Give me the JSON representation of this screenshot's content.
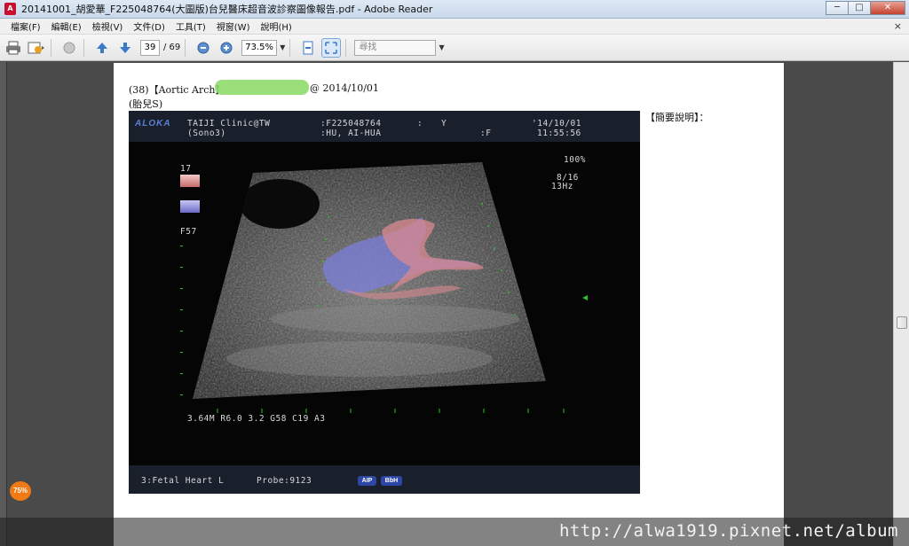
{
  "window": {
    "title": "20141001_胡愛華_F225048764(大圖版)台兒醫床超音波診察圖像報告.pdf - Adobe Reader",
    "app_icon": "pdf-icon",
    "buttons": [
      "─",
      "□",
      "✕"
    ]
  },
  "menu": {
    "items": [
      "檔案(F)",
      "編輯(E)",
      "檢視(V)",
      "文件(D)",
      "工具(T)",
      "視窗(W)",
      "說明(H)"
    ],
    "close": "×"
  },
  "toolbar": {
    "page_current": "39",
    "page_total": "/ 69",
    "zoom": "73.5%",
    "search_placeholder": "尋找",
    "icons": [
      "print-icon",
      "email-icon",
      "collaborate-icon",
      "page-up-icon",
      "page-down-icon",
      "zoom-out-icon",
      "zoom-in-icon",
      "fit-page-icon",
      "fullscreen-icon"
    ]
  },
  "document": {
    "heading_prefix": "(38)【Aortic Arch】",
    "heading_suffix": "@ 2014/10/01",
    "subheading": "(胎兒S)",
    "side_note": "【簡要說明】："
  },
  "ultrasound": {
    "brand": "ALOKA",
    "clinic": "TAIJI Clinic@TW",
    "probe_mode": "(Sono3)",
    "patient_id": ":F225048764",
    "id_sep": ":",
    "id_flag": "Y",
    "patient_name": ":HU, AI-HUA",
    "sex": ":F",
    "date": "'14/10/01",
    "time": "11:55:56",
    "scale_top": "17",
    "filter": "F57",
    "gain_pct": "100%",
    "frame": "8/16",
    "rate": "13Hz",
    "params": "3.64M R6.0 3.2 G58 C19 A3",
    "preset": "3:Fetal Heart L",
    "probe": "Probe:9123",
    "badge1": "AIP",
    "badge2": "BbH"
  },
  "watermark": "http://alwa1919.pixnet.net/album",
  "zoom_badge": "75%"
}
